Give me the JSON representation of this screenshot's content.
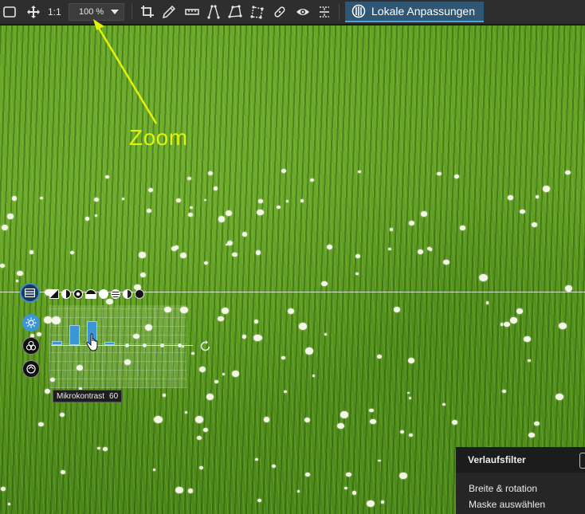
{
  "toolbar": {
    "ratio_label": "1:1",
    "zoom_value": "100 %",
    "local_adjustments_label": "Lokale Anpassungen",
    "icons": [
      "frame-icon",
      "move-icon",
      "crop-icon",
      "eyedropper-icon",
      "straighten-icon",
      "perspective-vertical-icon",
      "perspective-quad-icon",
      "perspective-rect-icon",
      "heal-icon",
      "preview-eye-icon",
      "compare-split-icon",
      "local-adjustments-icon"
    ]
  },
  "annotation": {
    "label": "Zoom",
    "color": "#e4f20a"
  },
  "adjustment_widget": {
    "mode_icons": [
      "exposure-icon",
      "contrast-icon",
      "microcontrast-icon",
      "shadows-icon",
      "circle-icon",
      "highlights-icon",
      "clarity-icon",
      "black-icon"
    ],
    "side_buttons": [
      "light-icon",
      "color-icon",
      "detail-icon"
    ],
    "bars_percent": [
      5,
      25,
      30,
      4,
      0,
      0,
      0,
      0
    ],
    "tooltip": {
      "label": "Mikrokontrast",
      "value": "60"
    },
    "accent_color": "#3c95d6"
  },
  "right_panel": {
    "title": "Verlaufsfilter",
    "items": [
      "Breite & rotation",
      "Maske auswählen"
    ]
  }
}
